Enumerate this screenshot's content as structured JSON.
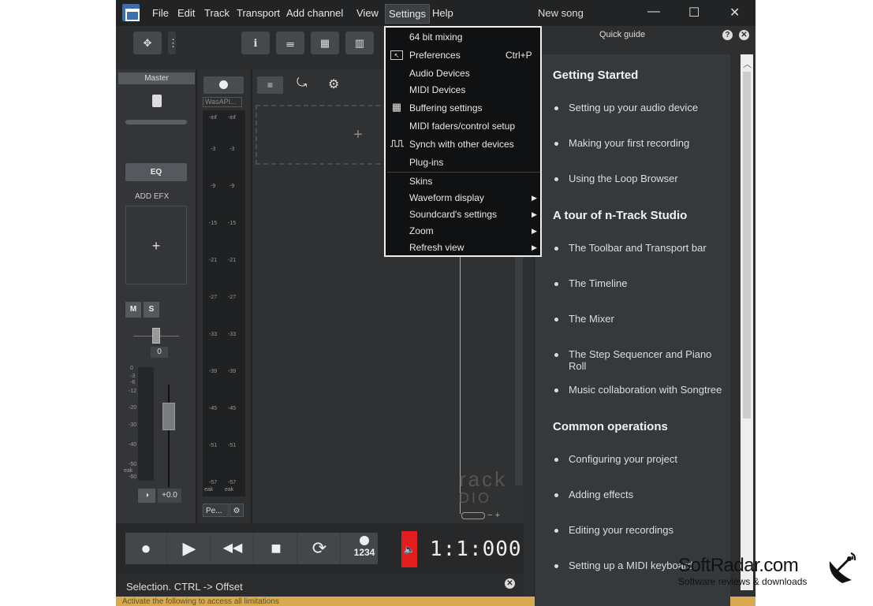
{
  "menubar": {
    "items": [
      "File",
      "Edit",
      "Track",
      "Transport",
      "Add channel",
      "View",
      "Settings",
      "Help"
    ],
    "active": "Settings"
  },
  "window": {
    "title": "New song",
    "minimize": "—",
    "maximize": "☐",
    "close": "✕"
  },
  "toolbar": {
    "move_icon": "✥",
    "more_icon": "⋮",
    "info_icon": "ℹ",
    "mixer_icon": "𝍢",
    "grid_icon": "▦",
    "piano_icon": "▥"
  },
  "master": {
    "label": "Master",
    "eq_label": "EQ",
    "add_efx_label": "ADD EFX",
    "add_plus": "+",
    "mute_label": "M",
    "solo_label": "S",
    "pan_value": "0",
    "gain_value": "+0.0",
    "meter_ticks": [
      "0",
      "-3",
      "-6",
      "-12",
      "-20",
      "-30",
      "-40",
      "-50",
      "eak",
      "-60"
    ]
  },
  "meter": {
    "device_label": "WasAPI...",
    "top_labels": [
      "-inf",
      "-inf"
    ],
    "ticks": [
      "-3",
      "-9",
      "-15",
      "-21",
      "-27",
      "-33",
      "-39",
      "-45",
      "-51",
      "-57"
    ],
    "bottom_label_left": "eak",
    "bottom_label_right": "eak",
    "preset_label": "Pe...",
    "gear_icon": "⚙"
  },
  "track_area": {
    "drop_plus": "+",
    "logo_line1": "rack",
    "logo_line2": "DIO",
    "zoom_minus": "−",
    "zoom_plus": "+"
  },
  "transport": {
    "record": "●",
    "play": "▶",
    "rewind": "◀◀",
    "stop": "■",
    "loop": "⟳",
    "click_label": "1234",
    "counter": "1:1:000"
  },
  "status": {
    "text": "Selection. CTRL -> Offset",
    "bottom_text": "Activate the following to access all limitations"
  },
  "guide": {
    "title": "Quick guide",
    "help": "?",
    "close": "✕",
    "sections": [
      {
        "heading": "Getting Started",
        "items": [
          "Setting up your audio device",
          "Making your first recording",
          "Using the Loop Browser"
        ]
      },
      {
        "heading": "A tour of n-Track Studio",
        "items": [
          "The Toolbar and Transport bar",
          "The Timeline",
          "The Mixer",
          "The Step Sequencer and Piano Roll",
          "Music collaboration with Songtree"
        ]
      },
      {
        "heading": "Common operations",
        "items": [
          "Configuring your project",
          "Adding effects",
          "Editing your recordings",
          "Setting up a MIDI keyboard"
        ]
      }
    ]
  },
  "settings_menu": {
    "items": [
      {
        "label": "64 bit mixing",
        "shortcut": "",
        "submenu": false
      },
      {
        "label": "Preferences",
        "shortcut": "Ctrl+P",
        "submenu": false
      },
      {
        "label": "Audio Devices",
        "shortcut": "",
        "submenu": false
      },
      {
        "label": "MIDI Devices",
        "shortcut": "",
        "submenu": false
      },
      {
        "label": "Buffering settings",
        "shortcut": "",
        "submenu": false
      },
      {
        "label": "MIDI faders/control setup",
        "shortcut": "",
        "submenu": false
      },
      {
        "label": "Synch with other devices",
        "shortcut": "",
        "submenu": false
      },
      {
        "label": "Plug-ins",
        "shortcut": "",
        "submenu": false
      },
      {
        "label": "Skins",
        "shortcut": "",
        "submenu": false
      },
      {
        "label": "Waveform display",
        "shortcut": "",
        "submenu": true
      },
      {
        "label": "Soundcard's settings",
        "shortcut": "",
        "submenu": true
      },
      {
        "label": "Zoom",
        "shortcut": "",
        "submenu": true
      },
      {
        "label": "Refresh view",
        "shortcut": "",
        "submenu": true
      }
    ],
    "submenu_arrow": "▶"
  },
  "watermark": {
    "brand": "SoftRadar.com",
    "tagline": "Software reviews & downloads"
  }
}
